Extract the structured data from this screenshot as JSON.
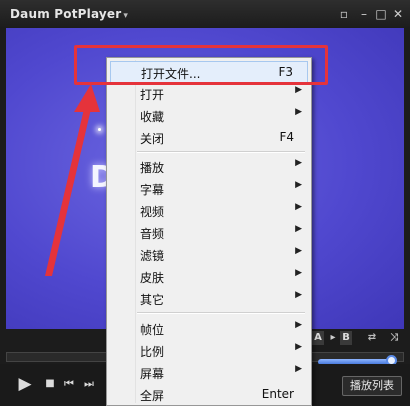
{
  "app": {
    "title": "Daum PotPlayer",
    "title_arrow": "▾"
  },
  "window_buttons": {
    "pin": "▫",
    "minimize": "–",
    "maximize": "□",
    "close": "✕"
  },
  "video": {
    "logo_text": "D"
  },
  "ab_buttons": {
    "a": "A",
    "b": "B"
  },
  "controls": {
    "play": "▶",
    "stop": "■",
    "prev": "⏮",
    "next": "⏭",
    "playlist": "播放列表"
  },
  "menu": {
    "items": [
      {
        "label": "打开文件...",
        "shortcut": "F3",
        "submenu": false,
        "highlighted": true
      },
      {
        "label": "打开",
        "shortcut": "",
        "submenu": true
      },
      {
        "label": "收藏",
        "shortcut": "",
        "submenu": true
      },
      {
        "label": "关闭",
        "shortcut": "F4",
        "submenu": false
      },
      {
        "label": "播放",
        "shortcut": "",
        "submenu": true
      },
      {
        "label": "字幕",
        "shortcut": "",
        "submenu": true
      },
      {
        "label": "视频",
        "shortcut": "",
        "submenu": true
      },
      {
        "label": "音频",
        "shortcut": "",
        "submenu": true
      },
      {
        "label": "滤镜",
        "shortcut": "",
        "submenu": true
      },
      {
        "label": "皮肤",
        "shortcut": "",
        "submenu": true
      },
      {
        "label": "其它",
        "shortcut": "",
        "submenu": true
      },
      {
        "label": "帧位",
        "shortcut": "",
        "submenu": true
      },
      {
        "label": "比例",
        "shortcut": "",
        "submenu": true
      },
      {
        "label": "屏幕",
        "shortcut": "",
        "submenu": true
      },
      {
        "label": "全屏",
        "shortcut": "Enter",
        "submenu": false
      }
    ],
    "chevron": "▶"
  },
  "colors": {
    "annotation": "#e5333b",
    "video_bg": "#5048cf"
  }
}
